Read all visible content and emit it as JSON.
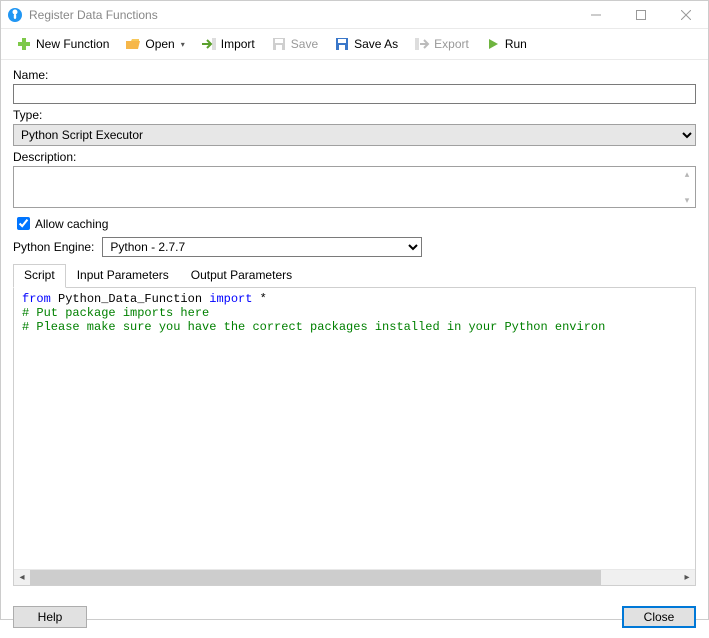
{
  "window": {
    "title": "Register Data Functions"
  },
  "toolbar": {
    "new_function": "New Function",
    "open": "Open",
    "import": "Import",
    "save": "Save",
    "save_as": "Save As",
    "export": "Export",
    "run": "Run"
  },
  "fields": {
    "name_label": "Name:",
    "name_value": "",
    "type_label": "Type:",
    "type_value": "Python Script Executor",
    "description_label": "Description:",
    "description_value": "",
    "allow_caching_label": "Allow caching",
    "allow_caching_checked": true,
    "python_engine_label": "Python Engine:",
    "python_engine_value": "Python - 2.7.7"
  },
  "tabs": {
    "script": "Script",
    "input_parameters": "Input Parameters",
    "output_parameters": "Output Parameters",
    "active": "script"
  },
  "script": {
    "line1_kw1": "from",
    "line1_mod": " Python_Data_Function ",
    "line1_kw2": "import",
    "line1_star": " *",
    "line2": "# Put package imports here",
    "line3": "# Please make sure you have the correct packages installed in your Python environ"
  },
  "footer": {
    "help": "Help",
    "close": "Close"
  }
}
